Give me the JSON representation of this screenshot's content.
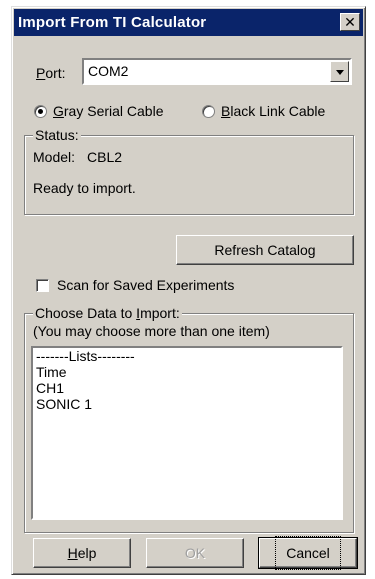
{
  "dialog": {
    "title": "Import From TI Calculator",
    "close_glyph": "✕",
    "close_icon": "close-icon"
  },
  "port": {
    "label_prefix": "",
    "label_hotkey": "P",
    "label_rest": "ort:",
    "value": "COM2"
  },
  "cable": {
    "options": [
      {
        "hotkey": "G",
        "rest": "ray Serial Cable",
        "selected": true
      },
      {
        "hotkey": "B",
        "rest": "lack Link Cable",
        "selected": false
      }
    ]
  },
  "status": {
    "legend": "Status:",
    "model_label": "Model:",
    "model_value": "CBL2",
    "message": "Ready to import."
  },
  "refresh_button": {
    "label": "Refresh Catalog"
  },
  "scan_checkbox": {
    "label": "Scan for Saved Experiments",
    "checked": false
  },
  "choose_data": {
    "legend_prefix": "Choose Data to ",
    "legend_hotkey": "I",
    "legend_rest": "mport:",
    "note": "(You may choose more than one item)",
    "items": [
      "-------Lists--------",
      "Time",
      "CH1",
      "SONIC 1"
    ]
  },
  "buttons": {
    "help_hotkey": "H",
    "help_rest": "elp",
    "ok": "OK",
    "cancel": "Cancel"
  }
}
